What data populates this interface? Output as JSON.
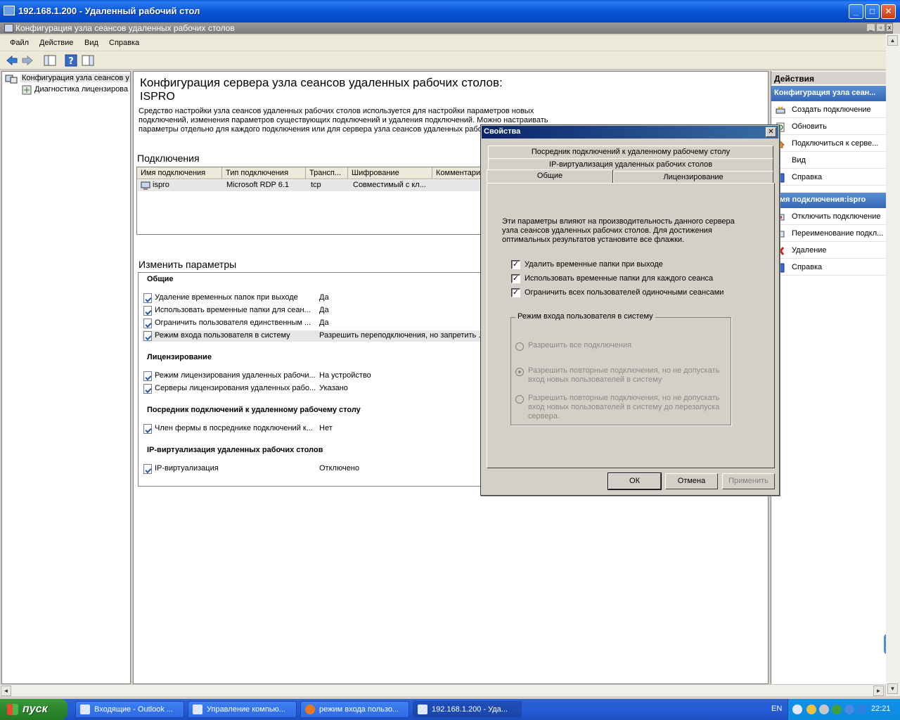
{
  "window": {
    "title": "192.168.1.200 - Удаленный рабочий стол"
  },
  "mmc": {
    "title": "Конфигурация узла сеансов удаленных рабочих столов"
  },
  "menu": [
    "Файл",
    "Действие",
    "Вид",
    "Справка"
  ],
  "tree": {
    "root": "Конфигурация узла сеансов у",
    "child": "Диагностика лицензирова"
  },
  "center": {
    "title": "Конфигурация сервера узла сеансов удаленных рабочих столов:",
    "server": "ISPRO",
    "desc": "Средство настройки узла сеансов удаленных рабочих столов используется для настройки параметров новых подключений, изменения параметров существующих подключений и удаления подключений. Можно настраивать параметры отдельно для каждого подключения или для сервера узла сеансов удаленных рабоч",
    "connections_title": "Подключения",
    "columns": [
      "Имя подключения",
      "Тип подключения",
      "Трансп...",
      "Шифрование",
      "Комментарий"
    ],
    "row": {
      "name": "ispro",
      "type": "Microsoft RDP 6.1",
      "transport": "tcp",
      "encryption": "Совместимый с кл..."
    },
    "params_title": "Изменить параметры",
    "groups": {
      "general": "Общие",
      "licensing": "Лицензирование",
      "broker": "Посредник подключений к удаленному рабочему столу",
      "ipvirt": "IP-виртуализация удаленных рабочих столов"
    },
    "params": [
      {
        "name": "Удаление временных папок при выходе",
        "value": "Да"
      },
      {
        "name": "Использовать временные папки для сеан...",
        "value": "Да"
      },
      {
        "name": "Ограничить пользователя единственным ...",
        "value": "Да"
      },
      {
        "name": "Режим входа пользователя в систему",
        "value": "Разрешить переподключения, но запретить ..."
      },
      {
        "name": "Режим лицензирования удаленных рабочи...",
        "value": "На устройство"
      },
      {
        "name": "Серверы лицензирования удаленных рабо...",
        "value": "Указано"
      },
      {
        "name": "Член фермы в посреднике подключений к...",
        "value": "Нет"
      },
      {
        "name": "IP-виртуализация",
        "value": "Отключено"
      }
    ]
  },
  "actions": {
    "header": "Действия",
    "section1": "Конфигурация узла сеан...",
    "items1": [
      "Создать подключение",
      "Обновить",
      "Подключиться к серве...",
      "Вид",
      "Справка"
    ],
    "section2": "Имя подключения:ispro",
    "items2": [
      "Отключить подключение",
      "Переименование подкл...",
      "Удаление",
      "Справка"
    ]
  },
  "dialog": {
    "title": "Свойства",
    "tabs": [
      "Посредник подключений к удаленному рабочему столу",
      "IP-виртуализация удаленных рабочих столов",
      "Общие",
      "Лицензирование"
    ],
    "intro": "Эти параметры влияют на производительность данного сервера узла сеансов удаленных рабочих столов. Для достижения оптимальных результатов установите все флажки.",
    "checks": [
      {
        "label": "Удалить временные папки при выходе",
        "checked": true
      },
      {
        "label": "Использовать временные папки для каждого сеанса",
        "checked": true
      },
      {
        "label": "Ограничить всех пользователей одиночными сеансами",
        "checked": true
      }
    ],
    "group_title": "Режим входа пользователя в систему",
    "radios": [
      {
        "label": "Разрешить все подключения",
        "selected": false
      },
      {
        "label": "Разрешить повторные подключения, но не допускать вход новых пользователей в систему",
        "selected": true
      },
      {
        "label": "Разрешить повторные подключения, но не допускать вход новых пользователей в систему до перезапуска сервера.",
        "selected": false
      }
    ],
    "ok": "ОК",
    "cancel": "Отмена",
    "apply": "Применить"
  },
  "taskbar": {
    "start": "пуск",
    "tasks": [
      "Входящие - Outlook ...",
      "Управление компью...",
      "режим входа пользо...",
      "192.168.1.200 - Уда..."
    ],
    "lang": "EN",
    "clock": "22:21"
  },
  "colors": {
    "xp_blue": "#0a56d8",
    "start_green": "#2f8a2f",
    "dialog_title": "#0a246a"
  }
}
